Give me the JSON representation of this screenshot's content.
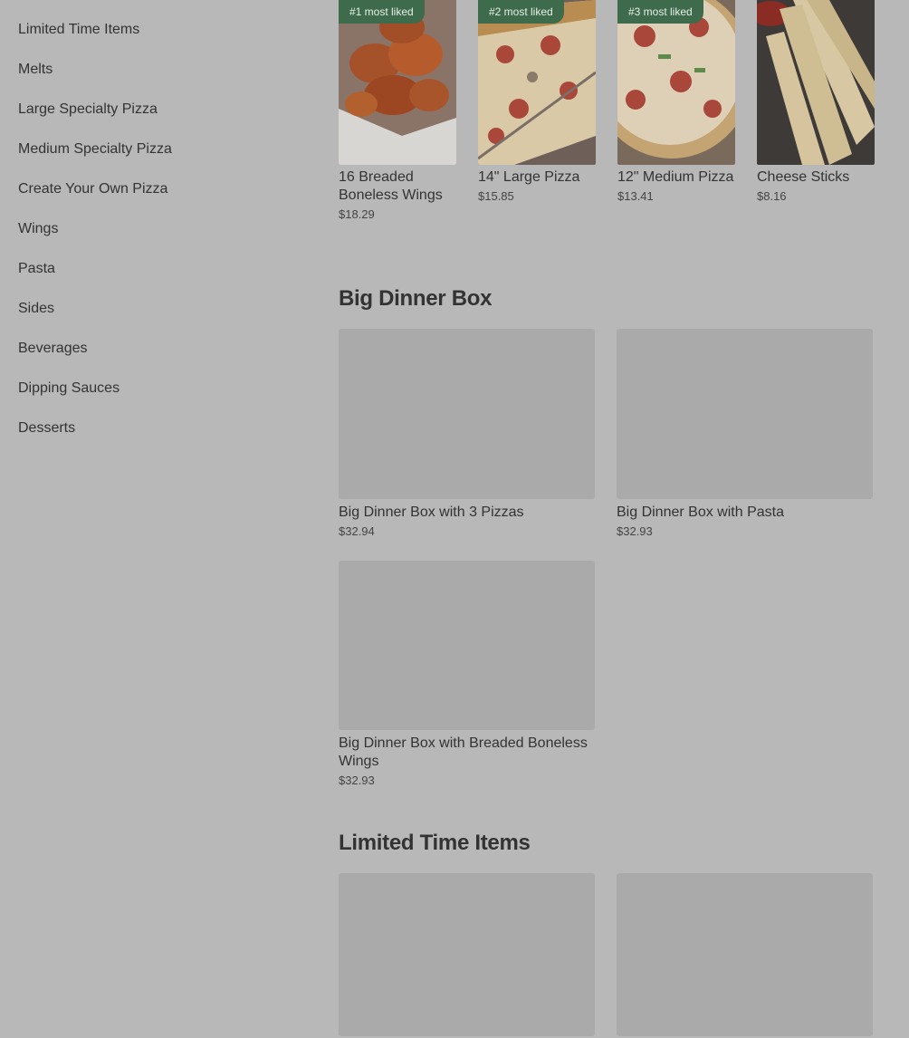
{
  "sidebar": {
    "items": [
      {
        "label": "Limited Time Items"
      },
      {
        "label": "Melts"
      },
      {
        "label": "Large Specialty Pizza"
      },
      {
        "label": "Medium Specialty Pizza"
      },
      {
        "label": "Create Your Own Pizza"
      },
      {
        "label": "Wings"
      },
      {
        "label": "Pasta"
      },
      {
        "label": "Sides"
      },
      {
        "label": "Beverages"
      },
      {
        "label": "Dipping Sauces"
      },
      {
        "label": "Desserts"
      }
    ]
  },
  "popular": [
    {
      "badge": "#1 most liked",
      "name": "16 Breaded Boneless Wings",
      "price": "$18.29",
      "image": "wings"
    },
    {
      "badge": "#2 most liked",
      "name": "14\" Large Pizza",
      "price": "$15.85",
      "image": "large-pizza"
    },
    {
      "badge": "#3 most liked",
      "name": "12\" Medium Pizza",
      "price": "$13.41",
      "image": "medium-pizza"
    },
    {
      "badge": "",
      "name": "Cheese Sticks",
      "price": "$8.16",
      "image": "cheese-sticks"
    }
  ],
  "big_dinner_box": {
    "title": "Big Dinner Box",
    "items": [
      {
        "name": "Big Dinner Box with 3 Pizzas",
        "price": "$32.94"
      },
      {
        "name": "Big Dinner Box with Pasta",
        "price": "$32.93"
      },
      {
        "name": "Big Dinner Box with Breaded Boneless Wings",
        "price": "$32.93"
      }
    ]
  },
  "limited_time": {
    "title": "Limited Time Items"
  },
  "colors": {
    "overlay_bg": "#b8b8b8",
    "placeholder": "#aaaaaa",
    "badge": "#3e6b4b"
  }
}
